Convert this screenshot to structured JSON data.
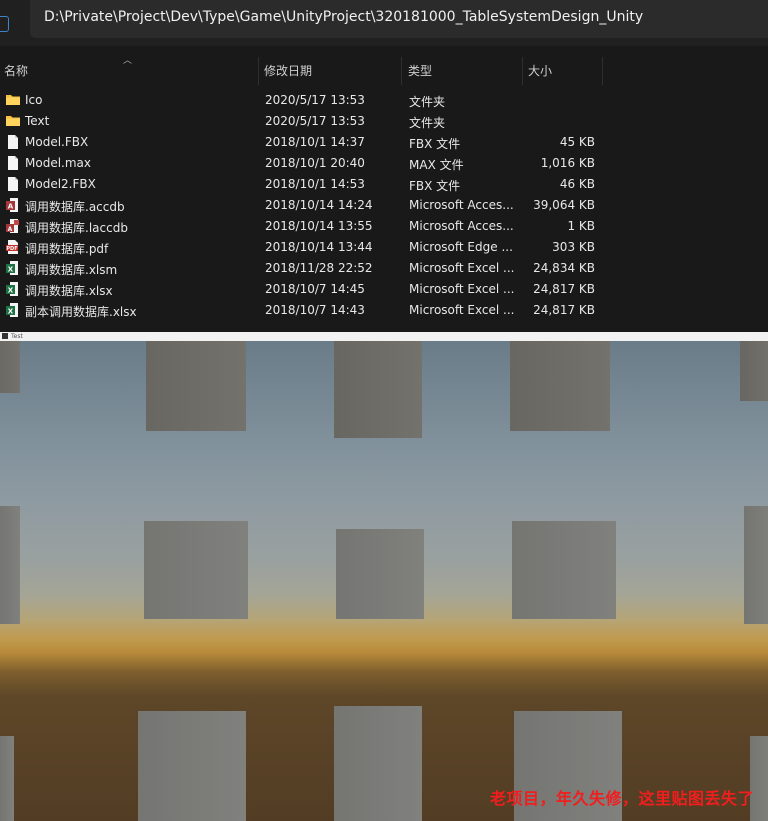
{
  "explorer": {
    "address_path": "D:\\Private\\Project\\Dev\\Type\\Game\\UnityProject\\320181000_TableSystemDesign_Unity",
    "columns": {
      "name": "名称",
      "date": "修改日期",
      "type": "类型",
      "size": "大小"
    },
    "files": [
      {
        "name": "Ico",
        "date": "2020/5/17 13:53",
        "type": "文件夹",
        "size": "",
        "icon": "folder-icon"
      },
      {
        "name": "Text",
        "date": "2020/5/17 13:53",
        "type": "文件夹",
        "size": "",
        "icon": "folder-icon"
      },
      {
        "name": "Model.FBX",
        "date": "2018/10/1 14:37",
        "type": "FBX 文件",
        "size": "45 KB",
        "icon": "file-icon"
      },
      {
        "name": "Model.max",
        "date": "2018/10/1 20:40",
        "type": "MAX 文件",
        "size": "1,016 KB",
        "icon": "file-icon"
      },
      {
        "name": "Model2.FBX",
        "date": "2018/10/1 14:53",
        "type": "FBX 文件",
        "size": "46 KB",
        "icon": "file-icon"
      },
      {
        "name": "调用数据库.accdb",
        "date": "2018/10/14 14:24",
        "type": "Microsoft Acces...",
        "size": "39,064 KB",
        "icon": "access-icon"
      },
      {
        "name": "调用数据库.laccdb",
        "date": "2018/10/14 13:55",
        "type": "Microsoft Acces...",
        "size": "1 KB",
        "icon": "access-lock-icon"
      },
      {
        "name": "调用数据库.pdf",
        "date": "2018/10/14 13:44",
        "type": "Microsoft Edge ...",
        "size": "303 KB",
        "icon": "pdf-icon"
      },
      {
        "name": "调用数据库.xlsm",
        "date": "2018/11/28 22:52",
        "type": "Microsoft Excel ...",
        "size": "24,834 KB",
        "icon": "excel-icon"
      },
      {
        "name": "调用数据库.xlsx",
        "date": "2018/10/7 14:45",
        "type": "Microsoft Excel ...",
        "size": "24,817 KB",
        "icon": "excel-icon"
      },
      {
        "name": "副本调用数据库.xlsx",
        "date": "2018/10/7 14:43",
        "type": "Microsoft Excel ...",
        "size": "24,817 KB",
        "icon": "excel-icon"
      }
    ]
  },
  "game": {
    "window_title": "Test",
    "caption": "老项目，年久失修，这里贴图丢失了"
  },
  "colors": {
    "caption": "#f21d1d",
    "folder": "#f4c242",
    "excel": "#1e7145",
    "access": "#a4373a",
    "pdf": "#c4302b"
  }
}
